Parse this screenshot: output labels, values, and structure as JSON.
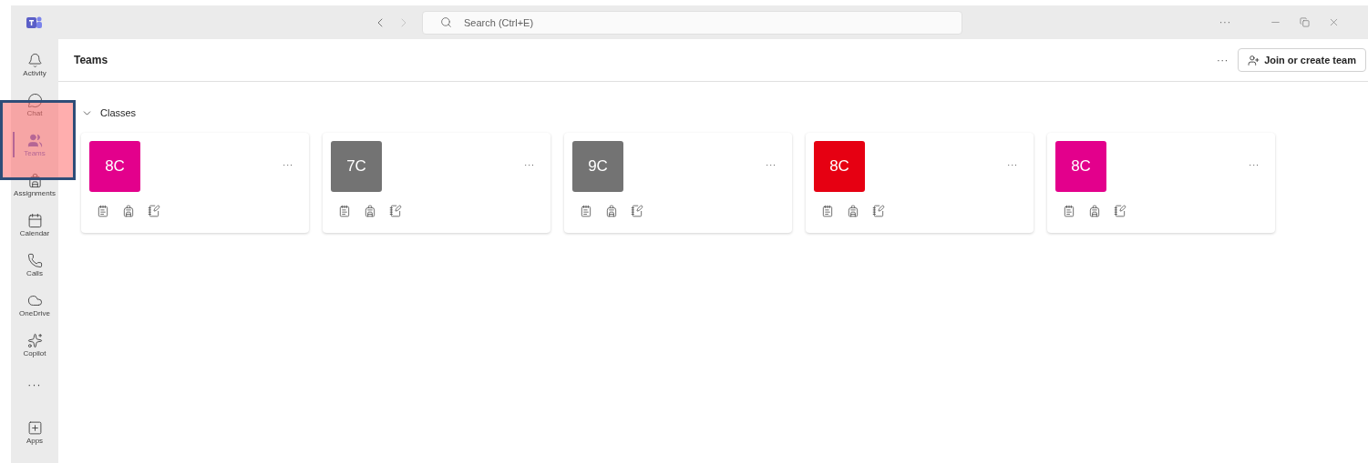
{
  "title_bar": {
    "search": {
      "placeholder": "Search (Ctrl+E)"
    },
    "more": "···"
  },
  "sidebar": {
    "items": [
      {
        "kind": "activity",
        "label": "Activity",
        "selected": false
      },
      {
        "kind": "chat",
        "label": "Chat",
        "selected": false
      },
      {
        "kind": "teams",
        "label": "Teams",
        "selected": true
      },
      {
        "kind": "assignments",
        "label": "Assignments",
        "selected": false
      },
      {
        "kind": "calendar",
        "label": "Calendar",
        "selected": false
      },
      {
        "kind": "calls",
        "label": "Calls",
        "selected": false
      },
      {
        "kind": "onedrive",
        "label": "OneDrive",
        "selected": false
      },
      {
        "kind": "copilot",
        "label": "Copilot",
        "selected": false
      },
      {
        "kind": "more",
        "label": "···",
        "selected": false
      },
      {
        "kind": "apps",
        "label": "Apps",
        "selected": false
      }
    ]
  },
  "header": {
    "title": "Teams",
    "more": "···",
    "join_button": "Join or create team"
  },
  "section": {
    "title": "Classes",
    "expanded": true,
    "cards": [
      {
        "initials": "8C",
        "color": "#e3008c",
        "more": "···"
      },
      {
        "initials": "7C",
        "color": "#737373",
        "more": "···"
      },
      {
        "initials": "9C",
        "color": "#737373",
        "more": "···"
      },
      {
        "initials": "8C",
        "color": "#e60012",
        "more": "···"
      },
      {
        "initials": "8C",
        "color": "#e3008c",
        "more": "···"
      }
    ]
  }
}
